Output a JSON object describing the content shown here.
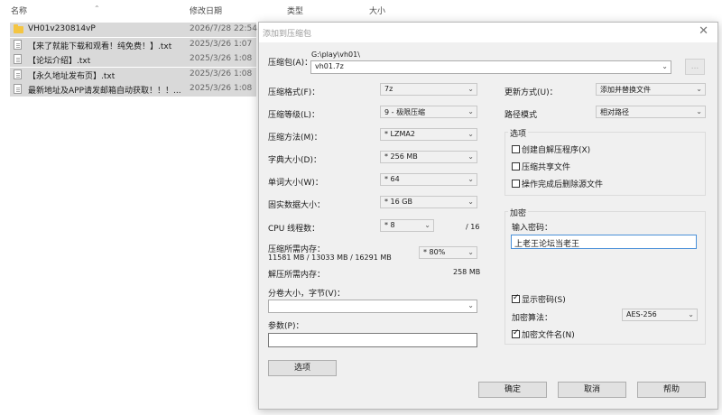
{
  "explorer": {
    "columns": {
      "name": "名称",
      "modified": "修改日期",
      "type": "类型",
      "size": "大小"
    },
    "files": [
      {
        "name": "VH01v230814vP",
        "date": "2026/7/28 22:54",
        "icon": "folder-icon"
      },
      {
        "name": "【来了就能下载和观看！纯免费！】.txt",
        "date": "2025/3/26 1:07",
        "icon": "text-file-icon"
      },
      {
        "name": "【论坛介绍】.txt",
        "date": "2025/3/26 1:08",
        "icon": "text-file-icon"
      },
      {
        "name": "【永久地址发布页】.txt",
        "date": "2025/3/26 1:08",
        "icon": "text-file-icon"
      },
      {
        "name": "最新地址及APP请发邮箱自动获取！！！...",
        "date": "2025/3/26 1:08",
        "icon": "text-file-icon"
      }
    ]
  },
  "dialog": {
    "title": "添加到压缩包",
    "close_glyph": "✕",
    "archive_label": "压缩包(A)：",
    "archive_path": "G:\\play\\vh01\\",
    "archive_name": "vh01.7z",
    "browse_label": "...",
    "format_label": "压缩格式(F)：",
    "format_value": "7z",
    "level_label": "压缩等级(L)：",
    "level_value": "9 - 极限压缩",
    "method_label": "压缩方法(M)：",
    "method_value": "* LZMA2",
    "dict_label": "字典大小(D)：",
    "dict_value": "* 256 MB",
    "word_label": "单词大小(W)：",
    "word_value": "* 64",
    "solid_label": "固实数据大小：",
    "solid_value": "* 16 GB",
    "threads_label": "CPU 线程数：",
    "threads_value": "* 8",
    "threads_max": "/ 16",
    "mem_comp_label": "压缩所需内存：",
    "mem_comp_detail": "11581 MB / 13033 MB / 16291 MB",
    "mem_comp_value": "* 80%",
    "mem_decomp_label": "解压所需内存：",
    "mem_decomp_value": "258 MB",
    "split_label": "分卷大小，字节(V)：",
    "params_label": "参数(P)：",
    "options_button": "选项",
    "update_label": "更新方式(U)：",
    "update_value": "添加并替换文件",
    "pathmode_label": "路径模式",
    "pathmode_value": "相对路径",
    "options_group": "选项",
    "opt_sfx": "创建自解压程序(X)",
    "opt_shared": "压缩共享文件",
    "opt_delete": "操作完成后删除源文件",
    "encrypt_group": "加密",
    "password_label": "输入密码：",
    "password_value": "上老王论坛当老王",
    "show_password": "显示密码(S)",
    "enc_method_label": "加密算法：",
    "enc_method_value": "AES-256",
    "encrypt_names": "加密文件名(N)",
    "ok_button": "确定",
    "cancel_button": "取消",
    "help_button": "帮助"
  },
  "glyphs": {
    "dropdown": "⌄",
    "sort": "⌃"
  }
}
